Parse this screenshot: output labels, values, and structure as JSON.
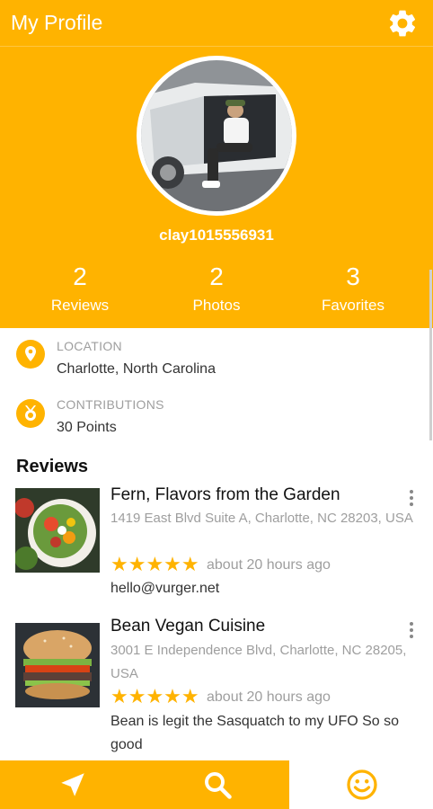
{
  "app": {
    "title": "My Profile",
    "accent_color": "#FFB300",
    "settings_icon": "gear-icon"
  },
  "profile": {
    "username": "clay1015556931",
    "stats": [
      {
        "value": "2",
        "label": "Reviews"
      },
      {
        "value": "2",
        "label": "Photos"
      },
      {
        "value": "3",
        "label": "Favorites"
      }
    ],
    "location": {
      "label": "LOCATION",
      "value": "Charlotte, North Carolina",
      "icon": "location-pin-icon"
    },
    "contributions": {
      "label": "CONTRIBUTIONS",
      "value": "30 Points",
      "icon": "medal-icon"
    }
  },
  "reviews_section": {
    "title": "Reviews",
    "items": [
      {
        "name": "Fern, Flavors from the Garden",
        "address": "1419 East Blvd Suite A, Charlotte, NC 28203, USA",
        "rating": 5,
        "stars": "★★★★★",
        "time": "about 20 hours ago",
        "text": "hello@vurger.net"
      },
      {
        "name": "Bean Vegan Cuisine",
        "address": "3001 E Independence Blvd, Charlotte, NC 28205, USA",
        "rating": 5,
        "stars": "★★★★★",
        "time": "about 20 hours ago",
        "text": "Bean is legit the Sasquatch to my UFO So so good"
      }
    ]
  },
  "navbar": {
    "items": [
      {
        "icon": "navigation-arrow-icon",
        "active": false
      },
      {
        "icon": "search-icon",
        "active": false
      },
      {
        "icon": "smiley-face-icon",
        "active": true
      }
    ]
  }
}
